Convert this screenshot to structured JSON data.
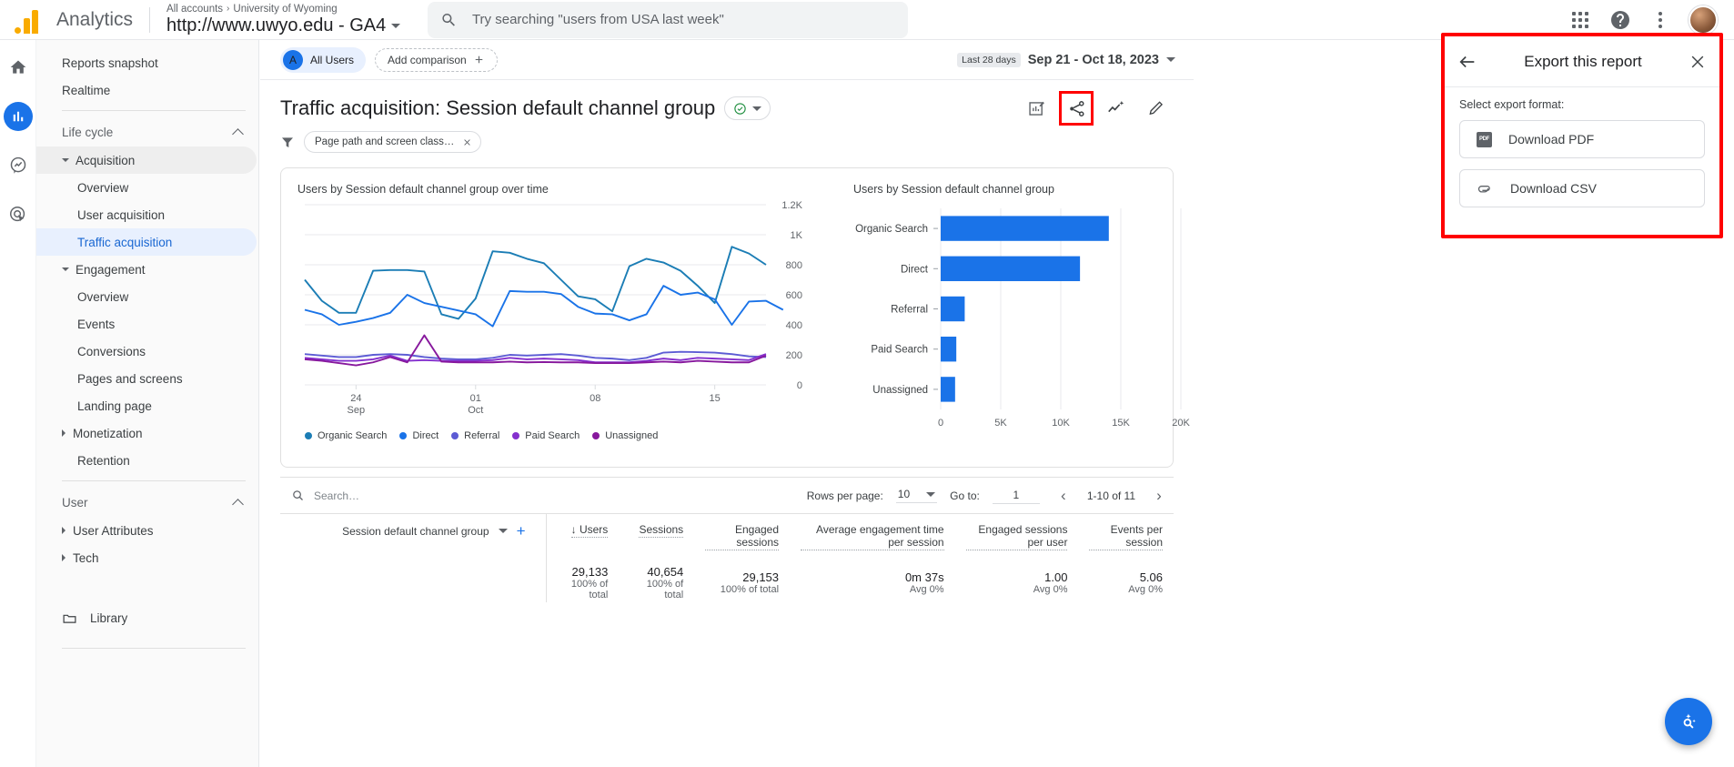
{
  "topbar": {
    "brand": "Analytics",
    "breadcrumb_root": "All accounts",
    "breadcrumb_sep": "›",
    "breadcrumb_account": "University of Wyoming",
    "property": "http://www.uwyo.edu - GA4",
    "search_placeholder": "Try searching \"users from USA last week\"",
    "search_value": "",
    "icons": {
      "search": "search-icon",
      "apps": "apps-grid-icon",
      "help": "help-icon",
      "more": "more-vert-icon",
      "avatar": "user-avatar"
    }
  },
  "rail": {
    "items": [
      {
        "name": "home-icon",
        "label": "Home",
        "active": false
      },
      {
        "name": "reports-icon",
        "label": "Reports",
        "active": true
      },
      {
        "name": "explore-icon",
        "label": "Explore",
        "active": false
      },
      {
        "name": "advertising-icon",
        "label": "Advertising",
        "active": false
      }
    ]
  },
  "sidebar": {
    "top_items": [
      {
        "label": "Reports snapshot",
        "selected": false
      },
      {
        "label": "Realtime",
        "selected": false
      }
    ],
    "sections": [
      {
        "title": "Life cycle",
        "collapsed": false,
        "groups": [
          {
            "label": "Acquisition",
            "expanded": true,
            "highlighted": true,
            "children": [
              {
                "label": "Overview",
                "selected": false
              },
              {
                "label": "User acquisition",
                "selected": false
              },
              {
                "label": "Traffic acquisition",
                "selected": true
              }
            ]
          },
          {
            "label": "Engagement",
            "expanded": true,
            "highlighted": false,
            "children": [
              {
                "label": "Overview",
                "selected": false
              },
              {
                "label": "Events",
                "selected": false
              },
              {
                "label": "Conversions",
                "selected": false
              },
              {
                "label": "Pages and screens",
                "selected": false
              },
              {
                "label": "Landing page",
                "selected": false
              }
            ]
          },
          {
            "label": "Monetization",
            "expanded": false,
            "highlighted": false,
            "children": []
          },
          {
            "label": "Retention",
            "expanded": null,
            "highlighted": false,
            "children": []
          }
        ]
      },
      {
        "title": "User",
        "collapsed": false,
        "groups": [
          {
            "label": "User Attributes",
            "expanded": false,
            "highlighted": false,
            "children": []
          },
          {
            "label": "Tech",
            "expanded": false,
            "highlighted": false,
            "children": []
          }
        ]
      }
    ],
    "library_label": "Library"
  },
  "report": {
    "audience_chip": {
      "initial": "A",
      "label": "All Users"
    },
    "add_comparison": "Add comparison",
    "date_badge": "Last 28 days",
    "date_range": "Sep 21 - Oct 18, 2023",
    "title": "Traffic acquisition: Session default channel group",
    "filter_chip": "Page path and screen class…",
    "actions": [
      {
        "name": "customize-report-icon",
        "label": "Customize report",
        "highlighted": false
      },
      {
        "name": "share-icon",
        "label": "Share this report",
        "highlighted": true
      },
      {
        "name": "insights-icon",
        "label": "Insights",
        "highlighted": false
      },
      {
        "name": "edit-icon",
        "label": "Edit",
        "highlighted": false
      }
    ]
  },
  "export_panel": {
    "title": "Export this report",
    "back_icon": "arrow-back-icon",
    "close_icon": "close-icon",
    "select_label": "Select export format:",
    "options": [
      {
        "icon": "pdf-icon",
        "label": "Download PDF"
      },
      {
        "icon": "csv-icon",
        "label": "Download CSV"
      }
    ],
    "highlight_color": "#ff0000"
  },
  "chart_data": [
    {
      "type": "line",
      "title": "Users by Session default channel group over time",
      "xlabel": "",
      "ylabel": "",
      "ylim": [
        0,
        1200
      ],
      "yticks": [
        "0",
        "200",
        "400",
        "600",
        "800",
        "1K",
        "1.2K"
      ],
      "xticks": [
        {
          "pos": 3,
          "top": "24",
          "bottom": "Sep"
        },
        {
          "pos": 10,
          "top": "01",
          "bottom": "Oct"
        },
        {
          "pos": 17,
          "top": "08",
          "bottom": ""
        },
        {
          "pos": 24,
          "top": "15",
          "bottom": ""
        }
      ],
      "grid": true,
      "legend_position": "bottom",
      "series": [
        {
          "name": "Organic Search",
          "color": "#1b7db5",
          "values": [
            700,
            560,
            480,
            480,
            760,
            765,
            765,
            755,
            470,
            440,
            575,
            890,
            880,
            840,
            810,
            700,
            590,
            570,
            490,
            790,
            840,
            815,
            760,
            660,
            545,
            920,
            875,
            800
          ]
        },
        {
          "name": "Direct",
          "color": "#1a73e8",
          "values": [
            500,
            470,
            400,
            420,
            445,
            480,
            600,
            545,
            520,
            495,
            470,
            390,
            625,
            620,
            620,
            605,
            520,
            475,
            470,
            430,
            470,
            660,
            600,
            615,
            570,
            400,
            555,
            560,
            500
          ]
        },
        {
          "name": "Referral",
          "color": "#5c5bd4",
          "values": [
            205,
            195,
            185,
            185,
            200,
            205,
            200,
            185,
            175,
            170,
            170,
            180,
            200,
            195,
            200,
            205,
            195,
            180,
            175,
            165,
            180,
            215,
            220,
            218,
            215,
            205,
            190,
            185
          ]
        },
        {
          "name": "Paid Search",
          "color": "#8430ce",
          "values": [
            180,
            170,
            160,
            160,
            170,
            195,
            160,
            165,
            160,
            160,
            160,
            165,
            180,
            170,
            175,
            170,
            165,
            150,
            150,
            150,
            160,
            175,
            165,
            180,
            175,
            170,
            165,
            205
          ]
        },
        {
          "name": "Unassigned",
          "color": "#87189d",
          "values": [
            170,
            160,
            145,
            130,
            150,
            185,
            150,
            330,
            155,
            150,
            150,
            150,
            155,
            150,
            152,
            150,
            150,
            145,
            145,
            145,
            150,
            155,
            150,
            160,
            155,
            150,
            150,
            195
          ]
        }
      ]
    },
    {
      "type": "bar",
      "orientation": "horizontal",
      "title": "Users by Session default channel group",
      "categories": [
        "Organic Search",
        "Direct",
        "Referral",
        "Paid Search",
        "Unassigned"
      ],
      "values": [
        14000,
        11600,
        2000,
        1300,
        1200
      ],
      "bar_color": "#1a73e8",
      "xticks": [
        "0",
        "5K",
        "10K",
        "15K",
        "20K"
      ],
      "xlim": [
        0,
        20000
      ],
      "grid": true
    }
  ],
  "table": {
    "search_placeholder": "Search…",
    "search_value": "",
    "rows_per_page_label": "Rows per page:",
    "rows_per_page_value": "10",
    "goto_label": "Go to:",
    "goto_value": "1",
    "range_label": "1-10 of 11",
    "dimension_header": "Session default channel group",
    "metric_headers": [
      "Users",
      "Sessions",
      "Engaged sessions",
      "Average engagement time per session",
      "Engaged sessions per user",
      "Events per session"
    ],
    "totals": [
      {
        "value": "29,133",
        "sub": "100% of total"
      },
      {
        "value": "40,654",
        "sub": "100% of total"
      },
      {
        "value": "29,153",
        "sub": "100% of total"
      },
      {
        "value": "0m 37s",
        "sub": "Avg 0%"
      },
      {
        "value": "1.00",
        "sub": "Avg 0%"
      },
      {
        "value": "5.06",
        "sub": "Avg 0%"
      }
    ]
  },
  "fab": {
    "name": "assistant-icon",
    "label": "Insights"
  }
}
